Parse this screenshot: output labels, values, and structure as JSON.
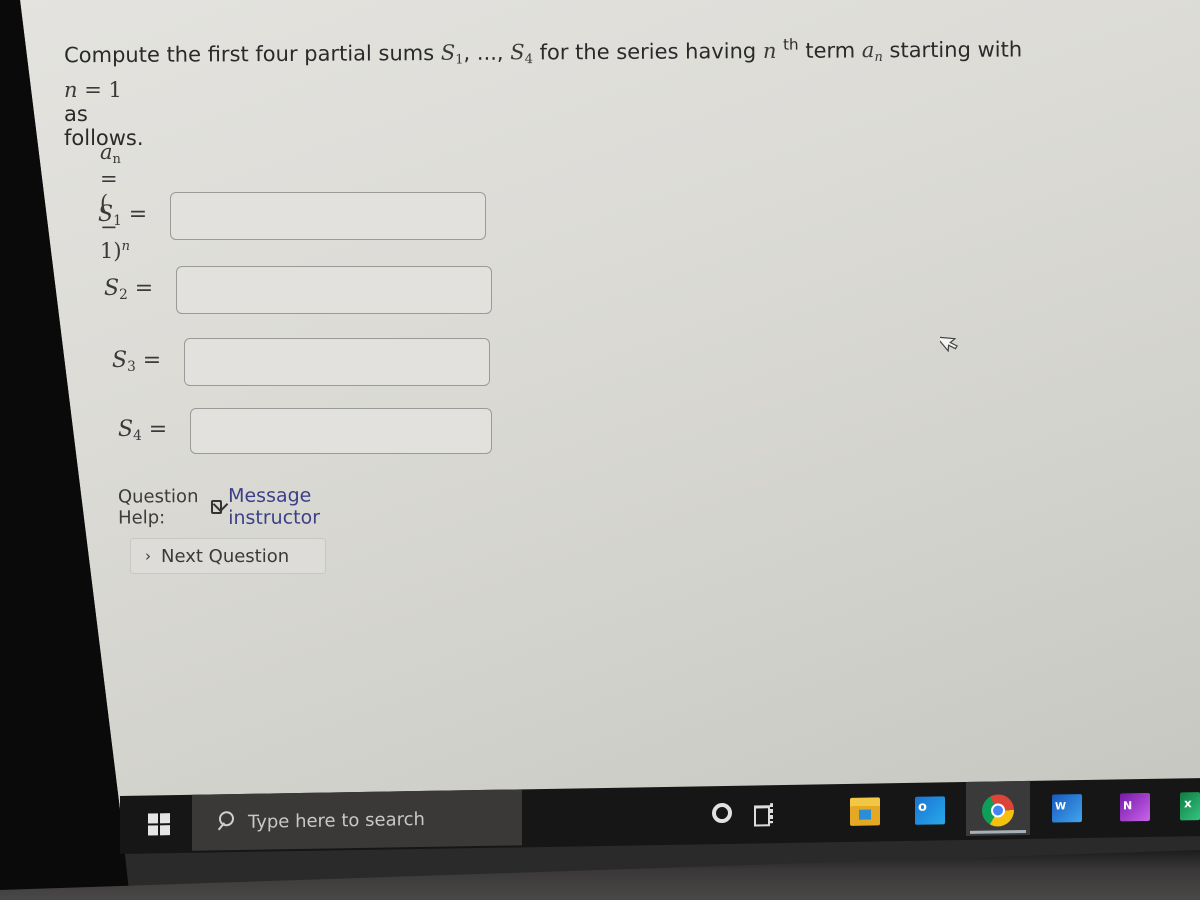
{
  "problem": {
    "prompt_before": "Compute the first four partial sums ",
    "s_first": "S",
    "s_first_sub": "1",
    "ellipsis": ", ..., ",
    "s_last": "S",
    "s_last_sub": "4",
    "prompt_middle": " for the series having ",
    "n_var": "n",
    "th": "th",
    "prompt_term": " term ",
    "a_var": "a",
    "a_sub": "n",
    "prompt_after": " starting with",
    "line2_var": "n",
    "line2_eq": " = 1",
    "line2_text": " as follows."
  },
  "formula": {
    "lhs": "a",
    "lhs_sub": "n",
    "rhs": " = ( − 1)",
    "exponent": "n"
  },
  "partial_sums": [
    {
      "label": "S",
      "sub": "1",
      "eq": " =",
      "value": "",
      "placeholder": ""
    },
    {
      "label": "S",
      "sub": "2",
      "eq": " =",
      "value": "",
      "placeholder": ""
    },
    {
      "label": "S",
      "sub": "3",
      "eq": " =",
      "value": "",
      "placeholder": ""
    },
    {
      "label": "S",
      "sub": "4",
      "eq": " =",
      "value": "",
      "placeholder": ""
    }
  ],
  "help": {
    "label": "Question Help:",
    "icon": "mail-icon",
    "link": "Message instructor"
  },
  "next_button": {
    "icon": "chevron-right-icon",
    "chevron": "›",
    "label": "Next Question"
  },
  "taskbar": {
    "search_placeholder": "Type here to search",
    "apps": [
      {
        "name": "cortana",
        "icon": "cortana-icon"
      },
      {
        "name": "task-view",
        "icon": "task-view-icon"
      },
      {
        "name": "file-explorer",
        "icon": "file-explorer-icon"
      },
      {
        "name": "outlook",
        "icon": "outlook-icon"
      },
      {
        "name": "chrome",
        "icon": "chrome-icon",
        "active": true
      },
      {
        "name": "word",
        "icon": "word-icon"
      },
      {
        "name": "onenote",
        "icon": "onenote-icon"
      },
      {
        "name": "excel",
        "icon": "excel-icon"
      }
    ]
  },
  "colors": {
    "link": "#3b3f86",
    "taskbar": "#161616",
    "search_box": "#3b3937"
  }
}
